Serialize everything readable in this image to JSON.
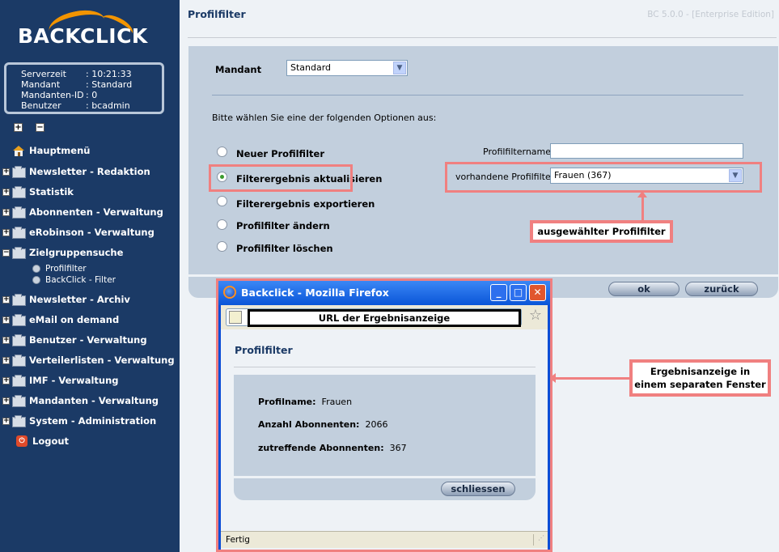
{
  "sidebar": {
    "logo": "BACKCLICK",
    "info": [
      {
        "key": "Serverzeit",
        "value": ": 10:21:33"
      },
      {
        "key": "Mandant",
        "value": ": Standard"
      },
      {
        "key": "Mandanten-ID",
        "value": ": 0"
      },
      {
        "key": "Benutzer",
        "value": ": bcadmin"
      }
    ],
    "expand_all": "+",
    "collapse_all": "−",
    "items": [
      {
        "label": "Hauptmenü"
      },
      {
        "label": "Newsletter - Redaktion"
      },
      {
        "label": "Statistik"
      },
      {
        "label": "Abonnenten - Verwaltung"
      },
      {
        "label": "eRobinson - Verwaltung"
      },
      {
        "label": "Zielgruppensuche"
      },
      {
        "label": "Newsletter - Archiv"
      },
      {
        "label": "eMail on demand"
      },
      {
        "label": "Benutzer - Verwaltung"
      },
      {
        "label": "Verteilerlisten - Verwaltung"
      },
      {
        "label": "IMF - Verwaltung"
      },
      {
        "label": "Mandanten - Verwaltung"
      },
      {
        "label": "System - Administration"
      },
      {
        "label": "Logout"
      }
    ],
    "subitems": [
      {
        "label": "Profilfilter"
      },
      {
        "label": "BackClick - Filter"
      }
    ]
  },
  "header": {
    "title": "Profilfilter",
    "version": "BC 5.0.0 - [Enterprise Edition]"
  },
  "form": {
    "mandant_label": "Mandant",
    "mandant_value": "Standard",
    "instruction": "Bitte wählen Sie eine der folgenden Optionen aus:",
    "options": [
      {
        "label": "Neuer Profilfilter",
        "checked": false
      },
      {
        "label": "Filterergebnis aktualisieren",
        "checked": true
      },
      {
        "label": "Filterergebnis exportieren",
        "checked": false
      },
      {
        "label": "Profilfilter ändern",
        "checked": false
      },
      {
        "label": "Profilfilter löschen",
        "checked": false
      }
    ],
    "profilfiltername_label": "Profilfiltername :",
    "profilfiltername_value": "",
    "vorhandene_label": "vorhandene Profilfilter :",
    "vorhandene_value": "Frauen (367)",
    "ok_label": "ok",
    "back_label": "zurück"
  },
  "annotations": {
    "selected_filter": "ausgewählter Profilfilter",
    "result_window": "Ergebnisanzeige in einem separaten Fenster",
    "url_note": "URL der Ergebnisanzeige"
  },
  "popup": {
    "window_title": "Backclick - Mozilla Firefox",
    "content_title": "Profilfilter",
    "rows": [
      {
        "label": "Profilname:",
        "value": "Frauen"
      },
      {
        "label": "Anzahl Abonnenten:",
        "value": "2066"
      },
      {
        "label": "zutreffende Abonnenten:",
        "value": "367"
      }
    ],
    "close_label": "schliessen",
    "status": "Fertig"
  }
}
